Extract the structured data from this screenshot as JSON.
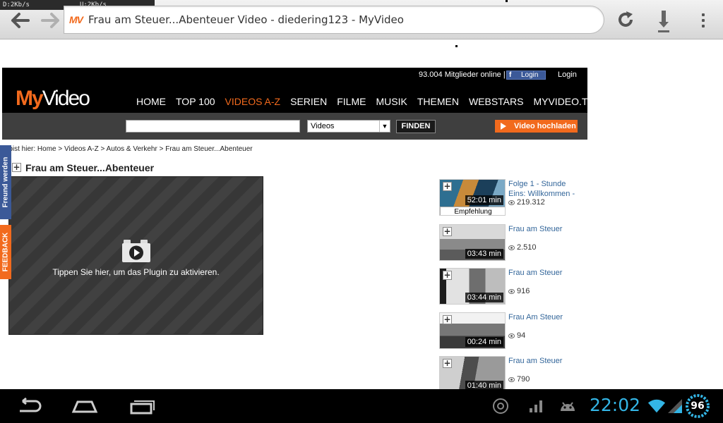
{
  "browser": {
    "net_down": "D:2Kb/s",
    "net_up": "U:2Kb/s",
    "favicon_text": "MV",
    "tab_title": "Frau am Steuer...Abenteuer Video - diedering123 - MyVideo"
  },
  "site": {
    "members_online": "93.004 Mitglieder online |",
    "fb_login": "Login",
    "login": "Login",
    "logo_my": "My",
    "logo_video": "Video",
    "nav": [
      "HOME",
      "TOP 100",
      "VIDEOS A-Z",
      "SERIEN",
      "FILME",
      "MUSIK",
      "THEMEN",
      "WEBSTARS",
      "MYVIDEO.TV"
    ],
    "nav_active_index": 2,
    "search": {
      "value": "",
      "select_value": "Videos",
      "button": "FINDEN"
    },
    "upload_button": "Video hochladen",
    "breadcrumb": "u bist hier: Home > Videos A-Z > Autos & Verkehr > Frau am Steuer...Abenteuer",
    "page_title": "Frau am Steuer...Abenteuer",
    "player_message": "Tippen Sie hier, um das Plugin zu aktivieren.",
    "side_tabs": {
      "friend": "Freund werden",
      "feedback": "FEEDBACK"
    },
    "related": [
      {
        "title": "Folge 1 - Stunde Eins: Willkommen -",
        "views": "219.312",
        "duration": "52:01 min",
        "badge": "Empfehlung"
      },
      {
        "title": "Frau am Steuer",
        "views": "2.510",
        "duration": "03:43 min"
      },
      {
        "title": "Frau am Steuer",
        "views": "916",
        "duration": "03:44 min"
      },
      {
        "title": "Frau Am Steuer",
        "views": "94",
        "duration": "00:24 min"
      },
      {
        "title": "Frau am Steuer",
        "views": "790",
        "duration": "01:40 min"
      }
    ]
  },
  "system": {
    "clock": "22:02",
    "battery": "96"
  },
  "colors": {
    "accent": "#f26a1d",
    "link": "#33669a",
    "android_blue": "#33b5e5",
    "facebook": "#3b5998"
  }
}
